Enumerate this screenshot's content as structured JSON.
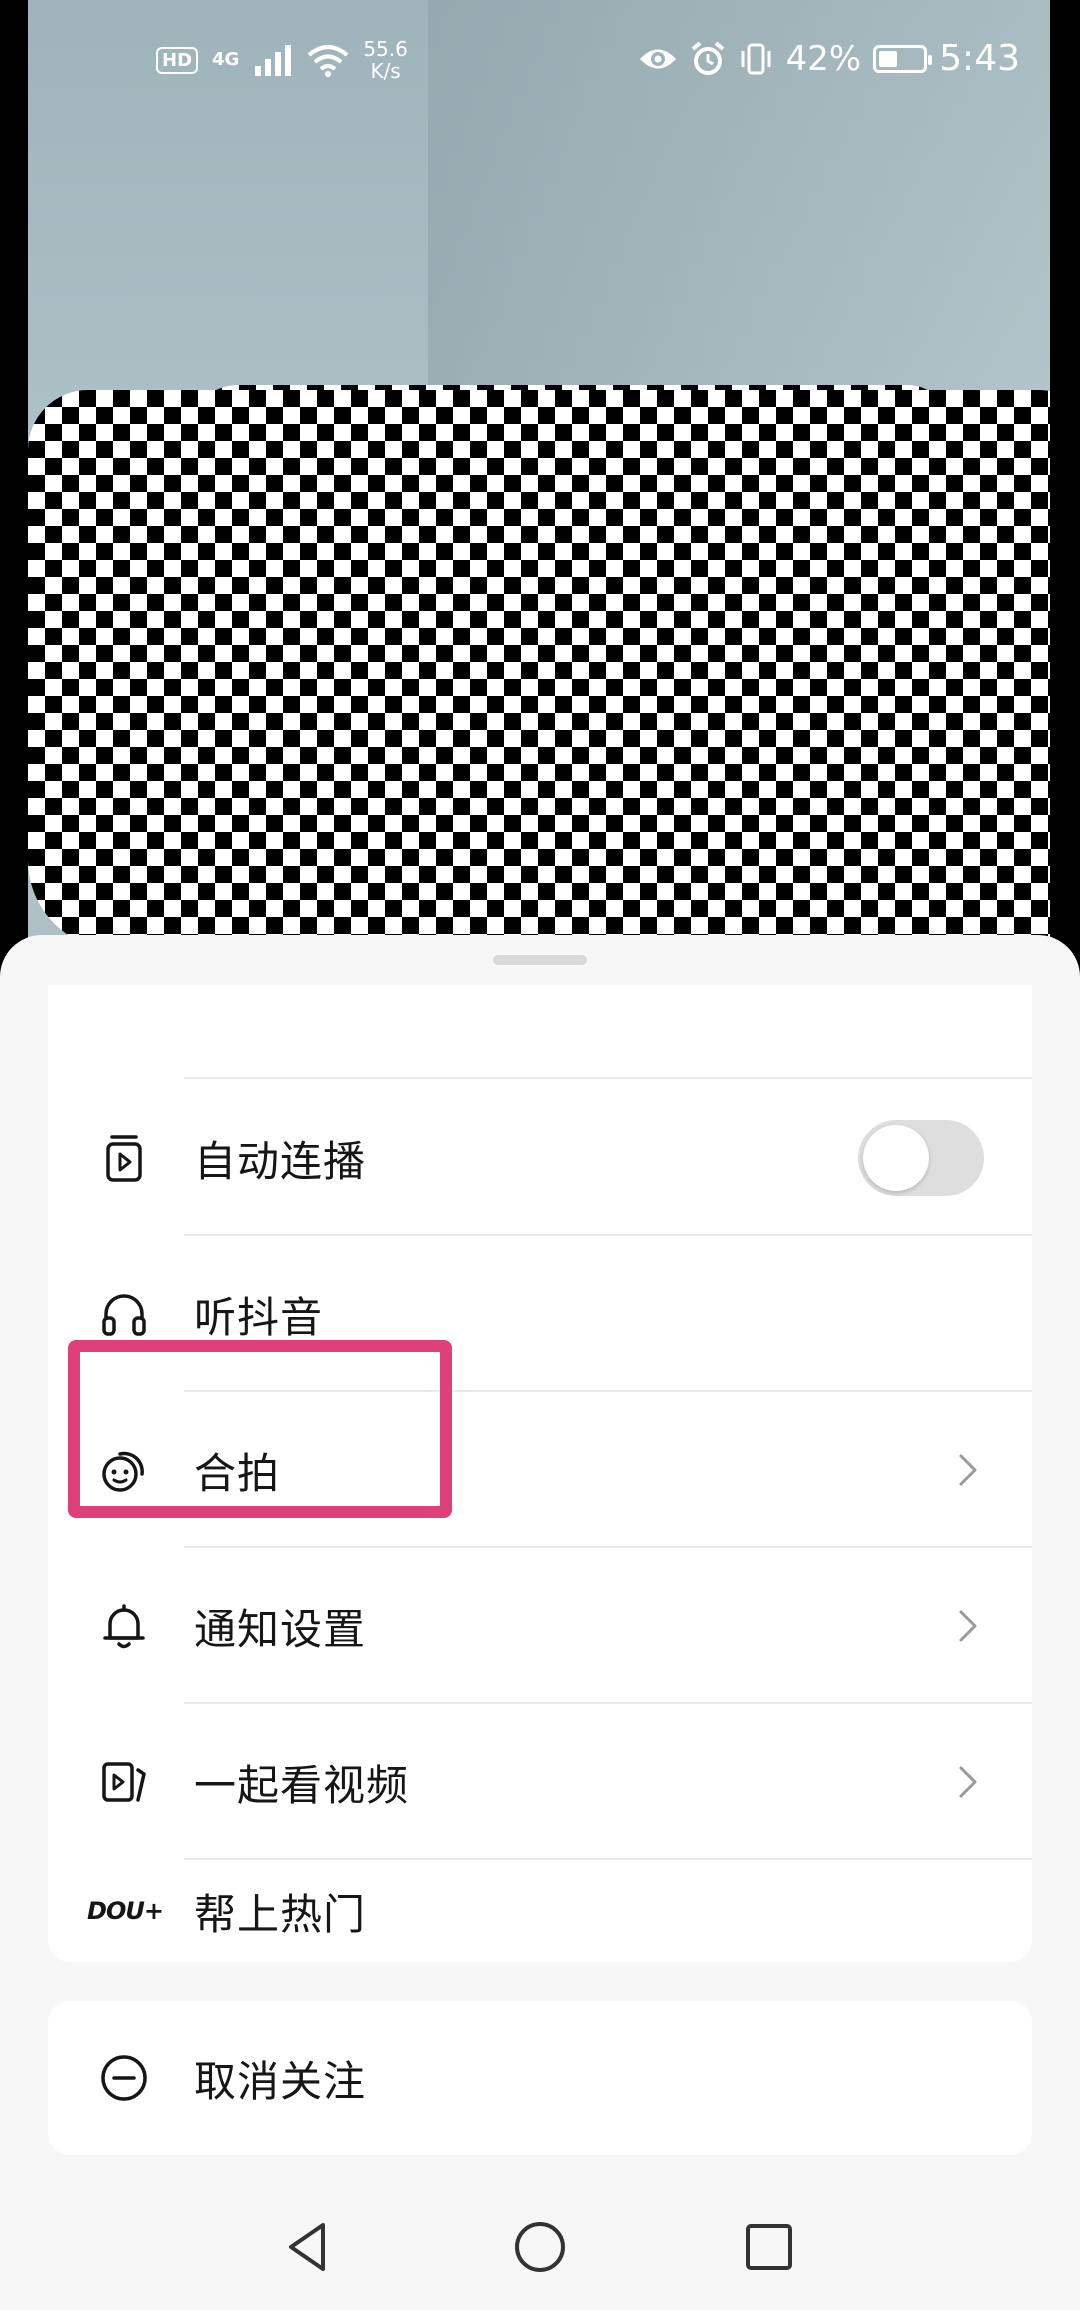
{
  "status_bar": {
    "hd": "HD",
    "network": "4G",
    "speed_value": "55.6",
    "speed_unit": "K/s",
    "battery_percent": "42%",
    "battery_level": 0.42,
    "time": "5:43"
  },
  "menu": {
    "items": [
      {
        "label": "自动连播",
        "icon": "autoplay-icon",
        "control": "toggle",
        "toggle_on": false
      },
      {
        "label": "听抖音",
        "icon": "headphones-icon",
        "control": "none"
      },
      {
        "label": "合拍",
        "icon": "duet-icon",
        "control": "chevron"
      },
      {
        "label": "通知设置",
        "icon": "bell-icon",
        "control": "chevron"
      },
      {
        "label": "一起看视频",
        "icon": "watch-together-icon",
        "control": "chevron"
      },
      {
        "label": "帮上热门",
        "icon": "dou-plus-icon",
        "icon_text": "DOU+",
        "control": "none"
      }
    ]
  },
  "unfollow": {
    "label": "取消关注",
    "icon": "minus-circle-icon"
  },
  "highlight": {
    "color": "#e0407a",
    "target": "合拍"
  },
  "colors": {
    "sheet_bg": "#f7f7f7",
    "card_bg": "#ffffff",
    "text": "#161616",
    "toggle_off": "#dedede"
  },
  "nav": {
    "back": "back-icon",
    "home": "home-icon",
    "recents": "recents-icon"
  }
}
